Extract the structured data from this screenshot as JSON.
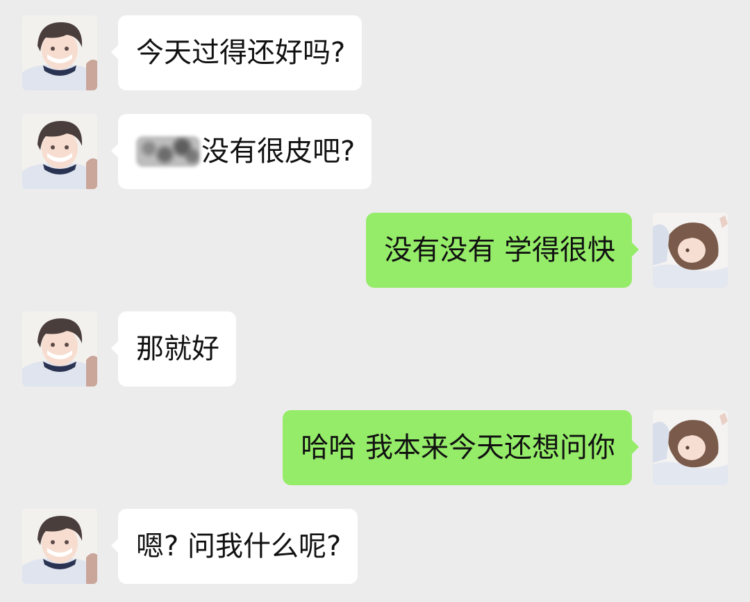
{
  "messages": [
    {
      "side": "left",
      "text": "今天过得还好吗?",
      "avatar_icon": "boy-avatar-icon"
    },
    {
      "side": "left",
      "text": "没有很皮吧?",
      "redacted_prefix": true,
      "avatar_icon": "boy-avatar-icon"
    },
    {
      "side": "right",
      "text": "没有没有  学得很快",
      "avatar_icon": "girl-avatar-icon"
    },
    {
      "side": "left",
      "text": "那就好",
      "avatar_icon": "boy-avatar-icon"
    },
    {
      "side": "right",
      "text": "哈哈  我本来今天还想问你",
      "avatar_icon": "girl-avatar-icon"
    },
    {
      "side": "left",
      "text": "嗯? 问我什么呢?",
      "avatar_icon": "boy-avatar-icon"
    }
  ],
  "colors": {
    "background": "#ececec",
    "incoming_bubble": "#ffffff",
    "outgoing_bubble": "#95ec69",
    "text": "#111111"
  }
}
